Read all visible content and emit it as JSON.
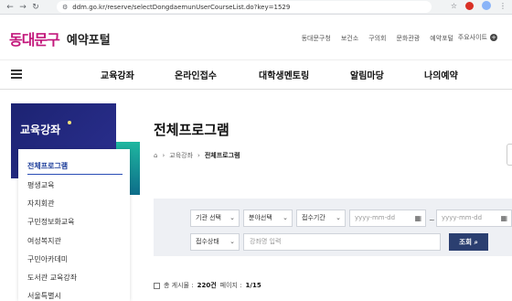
{
  "browser": {
    "url": "ddm.go.kr/reserve/selectDongdaemunUserCourseList.do?key=1529"
  },
  "header": {
    "logo_mark": "동대문구",
    "logo_text": "예약포털",
    "util_nav": [
      "동대문구청",
      "보건소",
      "구의회",
      "문화관광",
      "예약포털"
    ],
    "util_more": "주요사이트"
  },
  "gnb": {
    "items": [
      "교육강좌",
      "온라인접수",
      "대학생멘토링",
      "알림마당",
      "나의예약"
    ]
  },
  "sidebar": {
    "title": "교육강좌",
    "items": [
      "전체프로그램",
      "평생교육",
      "자치회관",
      "구민정보화교육",
      "여성복지관",
      "구민아카데미",
      "도서관 교육강좌",
      "서울특별시"
    ]
  },
  "main": {
    "page_title": "전체프로그램",
    "breadcrumb": [
      "교육강좌",
      "전체프로그램"
    ]
  },
  "search": {
    "org_select": "기관 선택",
    "field_select": "분야선택",
    "period_select": "접수기간",
    "date_from_placeholder": "yyyy-mm-dd",
    "date_to_placeholder": "yyyy-mm-dd",
    "tilde": "~",
    "status_select": "접수상태",
    "keyword_placeholder": "강좌명 입력",
    "search_button": "조회"
  },
  "summary": {
    "total_label": "총 게시물 :",
    "total_value": "220건",
    "page_label": "페이지 :",
    "page_value": "1/15"
  }
}
